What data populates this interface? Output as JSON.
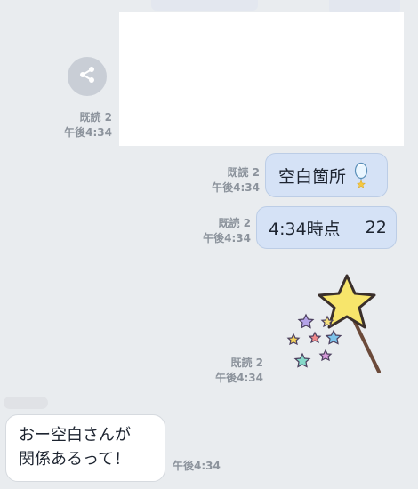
{
  "messages": [
    {
      "id": "m1",
      "read": "既読 2",
      "time": "午後4:34"
    },
    {
      "id": "m2",
      "read": "既読 2",
      "time": "午後4:34",
      "text": "空白箇所"
    },
    {
      "id": "m3",
      "read": "既読 2",
      "time": "午後4:34",
      "text_main": "4:34時点",
      "text_num": "22"
    },
    {
      "id": "m4",
      "read": "既読 2",
      "time": "午後4:34"
    },
    {
      "id": "m5",
      "time": "午後4:34",
      "text_line1": "おー空白さんが",
      "text_line2": "関係あるって！"
    }
  ],
  "icons": {
    "share": "share-icon",
    "balloon": "balloon-icon",
    "sticker": "star-wand-sticker"
  },
  "colors": {
    "background": "#e9ecef",
    "sent_bubble": "#d5e2f6",
    "received_bubble": "#ffffff",
    "meta_text": "#8c939c"
  }
}
